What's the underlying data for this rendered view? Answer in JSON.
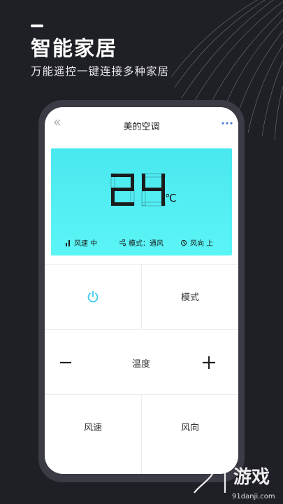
{
  "hero": {
    "title": "智能家居",
    "subtitle": "万能遥控一键连接多种家居"
  },
  "app": {
    "title": "美的空调",
    "back_icon": "double-chevron-left-icon",
    "more_icon": "more-dots-icon"
  },
  "display": {
    "temperature": "24",
    "unit": "℃",
    "status": {
      "fan_speed": "风速 中",
      "mode": "模式：通风",
      "direction": "风向 上"
    }
  },
  "controls": {
    "power_icon": "power-icon",
    "mode_label": "模式",
    "temp_label": "温度",
    "minus_label": "−",
    "plus_label": "+",
    "fan_speed_label": "风速",
    "direction_label": "风向"
  },
  "watermark": {
    "brand": "91游戏",
    "url": "91danji.com"
  },
  "colors": {
    "background": "#1f1f26",
    "display": "#55f0f4",
    "power": "#3cc9ea"
  }
}
